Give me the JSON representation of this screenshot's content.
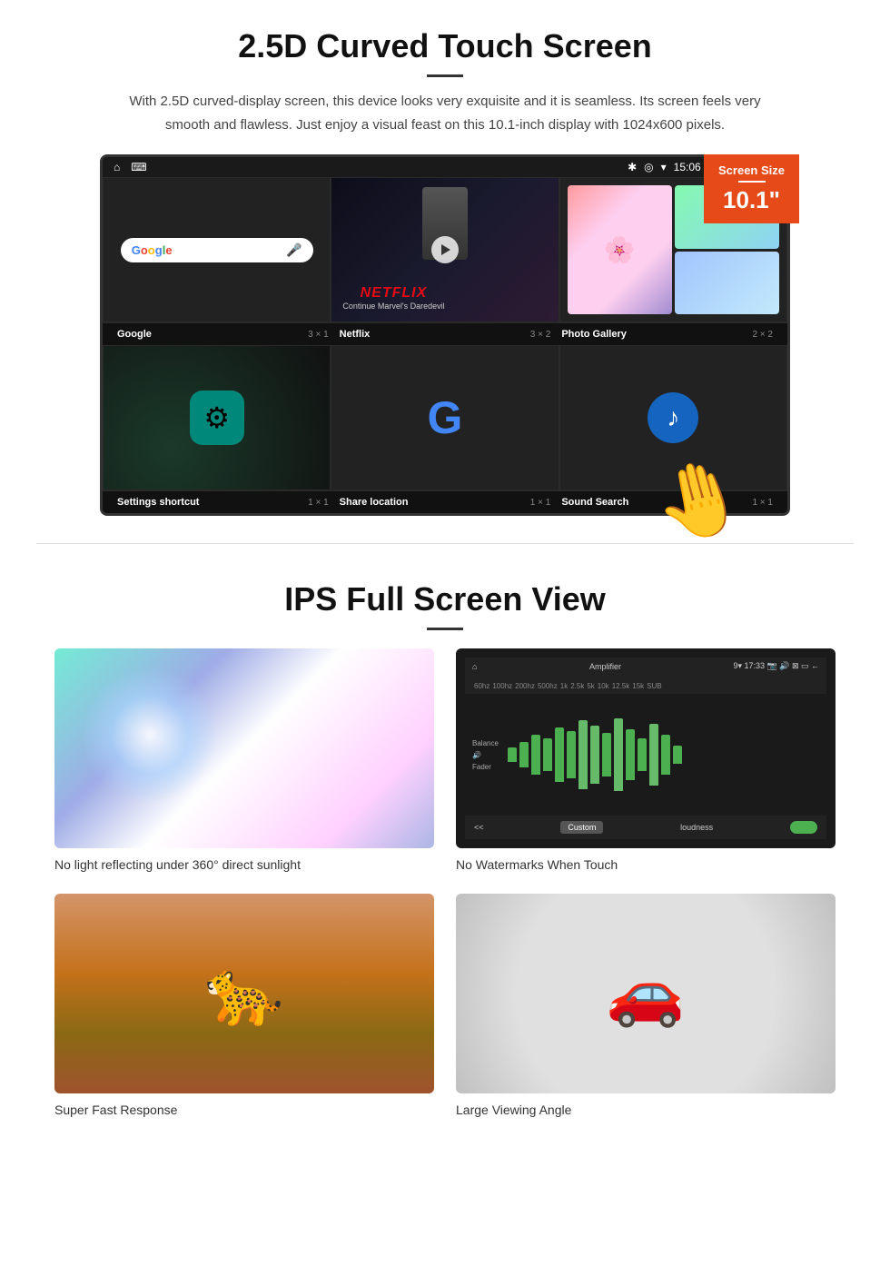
{
  "section1": {
    "title": "2.5D Curved Touch Screen",
    "description": "With 2.5D curved-display screen, this device looks very exquisite and it is seamless. Its screen feels very smooth and flawless. Just enjoy a visual feast on this 10.1-inch display with 1024x600 pixels.",
    "badge": {
      "label": "Screen Size",
      "size": "10.1\""
    },
    "status_bar": {
      "time": "15:06",
      "usb_icon": "⌨",
      "home_icon": "⌂"
    },
    "apps_top": [
      {
        "name": "Google",
        "size": "3 × 1"
      },
      {
        "name": "Netflix",
        "size": "3 × 2"
      },
      {
        "name": "Photo Gallery",
        "size": "2 × 2"
      }
    ],
    "apps_bottom": [
      {
        "name": "Settings shortcut",
        "size": "1 × 1"
      },
      {
        "name": "Share location",
        "size": "1 × 1"
      },
      {
        "name": "Sound Search",
        "size": "1 × 1"
      }
    ],
    "netflix_logo": "NETFLIX",
    "netflix_sub": "Continue Marvel's Daredevil"
  },
  "section2": {
    "title": "IPS Full Screen View",
    "features": [
      {
        "id": "sunlight",
        "caption": "No light reflecting under 360° direct sunlight"
      },
      {
        "id": "amplifier",
        "caption": "No Watermarks When Touch"
      },
      {
        "id": "cheetah",
        "caption": "Super Fast Response"
      },
      {
        "id": "car",
        "caption": "Large Viewing Angle"
      }
    ],
    "amp_bars": [
      8,
      14,
      22,
      18,
      30,
      26,
      38,
      32,
      24,
      40,
      28,
      18,
      34,
      22,
      10
    ]
  }
}
